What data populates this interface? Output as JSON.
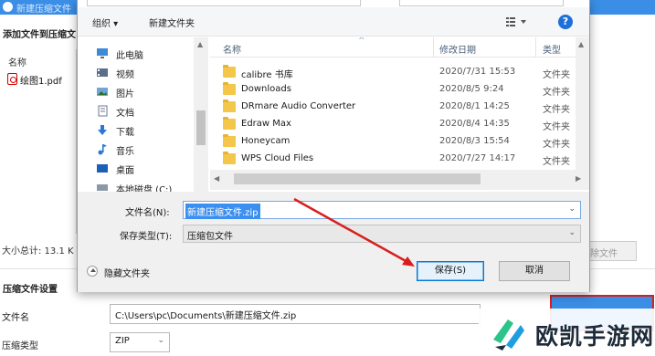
{
  "app": {
    "title": "新建压缩文件",
    "add_files_label": "添加文件到压缩文",
    "column_name": "名称",
    "files": [
      "绘图1.pdf"
    ],
    "total_size": "大小总计: 13.1 K",
    "settings_title": "压缩文件设置",
    "filename_label": "文件名",
    "filename_value": "C:\\Users\\pc\\Documents\\新建压缩文件.zip",
    "type_label": "压缩类型",
    "type_value": "ZIP",
    "disabled_button_label": "除文件"
  },
  "dialog": {
    "toolbar": {
      "organize": "组织 ▾",
      "new_folder": "新建文件夹",
      "help": "?"
    },
    "nav": [
      {
        "label": "此电脑",
        "icon": "computer-icon"
      },
      {
        "label": "视频",
        "icon": "video-icon"
      },
      {
        "label": "图片",
        "icon": "pictures-icon"
      },
      {
        "label": "文档",
        "icon": "documents-icon"
      },
      {
        "label": "下载",
        "icon": "download-icon"
      },
      {
        "label": "音乐",
        "icon": "music-icon"
      },
      {
        "label": "桌面",
        "icon": "desktop-icon"
      },
      {
        "label": "本地磁盘 (C:)",
        "icon": "drive-icon"
      }
    ],
    "columns": {
      "name": "名称",
      "date": "修改日期",
      "type": "类型"
    },
    "files": [
      {
        "name": "calibre 书库",
        "date": "2020/7/31 15:53",
        "type": "文件夹"
      },
      {
        "name": "Downloads",
        "date": "2020/8/5 9:24",
        "type": "文件夹"
      },
      {
        "name": "DRmare Audio Converter",
        "date": "2020/8/1 14:25",
        "type": "文件夹"
      },
      {
        "name": "Edraw Max",
        "date": "2020/8/4 14:35",
        "type": "文件夹"
      },
      {
        "name": "Honeycam",
        "date": "2020/8/3 15:54",
        "type": "文件夹"
      },
      {
        "name": "WPS Cloud Files",
        "date": "2020/7/27 14:17",
        "type": "文件夹"
      }
    ],
    "filename_label": "文件名(N):",
    "filename_value": "新建压缩文件.zip",
    "savetype_label": "保存类型(T):",
    "savetype_value": "压缩包文件",
    "hide_folders": "隐藏文件夹",
    "save_button": "保存(S)",
    "cancel_button": "取消"
  },
  "annotation": {
    "color": "#d81f1f"
  },
  "watermark": {
    "text": "欧凯手游网"
  }
}
